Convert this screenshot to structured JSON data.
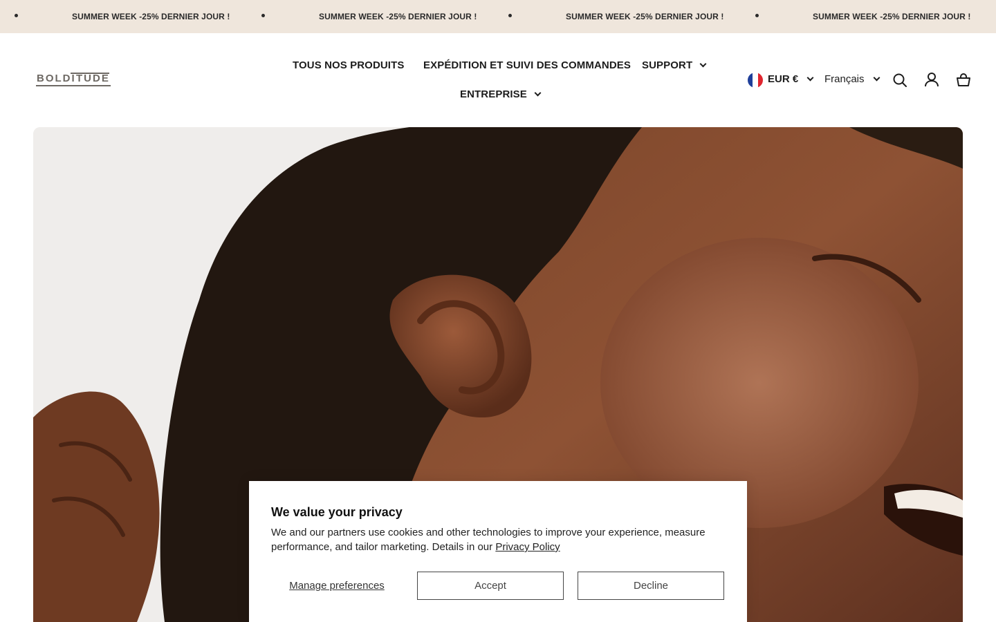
{
  "announcement": {
    "messages": [
      "SUMMER WEEK -25% DERNIER JOUR !",
      "SUMMER WEEK -25% DERNIER JOUR !",
      "SUMMER WEEK -25% DERNIER JOUR !",
      "SUMMER WEEK -25% DERNIER JOUR !"
    ]
  },
  "header": {
    "logo": {
      "left": "BOLDI",
      "right": "TUDE"
    },
    "nav": {
      "all_products": "TOUS NOS PRODUITS",
      "shipping": "EXPÉDITION ET SUIVI DES COMMANDES",
      "support": "SUPPORT",
      "company": "ENTREPRISE"
    },
    "currency": {
      "label": "EUR €",
      "flag": "france-flag"
    },
    "language": "Français",
    "icons": [
      "search-icon",
      "account-icon",
      "cart-icon"
    ]
  },
  "hero": {
    "image": "close-up-portrait-ear-earring"
  },
  "cookie_banner": {
    "title": "We value your privacy",
    "body": "We and our partners use cookies and other technologies to improve your experience, measure performance, and tailor marketing. Details in our ",
    "link": "Privacy Policy",
    "manage": "Manage preferences",
    "accept": "Accept",
    "decline": "Decline"
  },
  "colors": {
    "announcement_bg": "#efe6dc",
    "text": "#1c1c1c",
    "logo": "#6d6863",
    "button_border": "#444444"
  }
}
